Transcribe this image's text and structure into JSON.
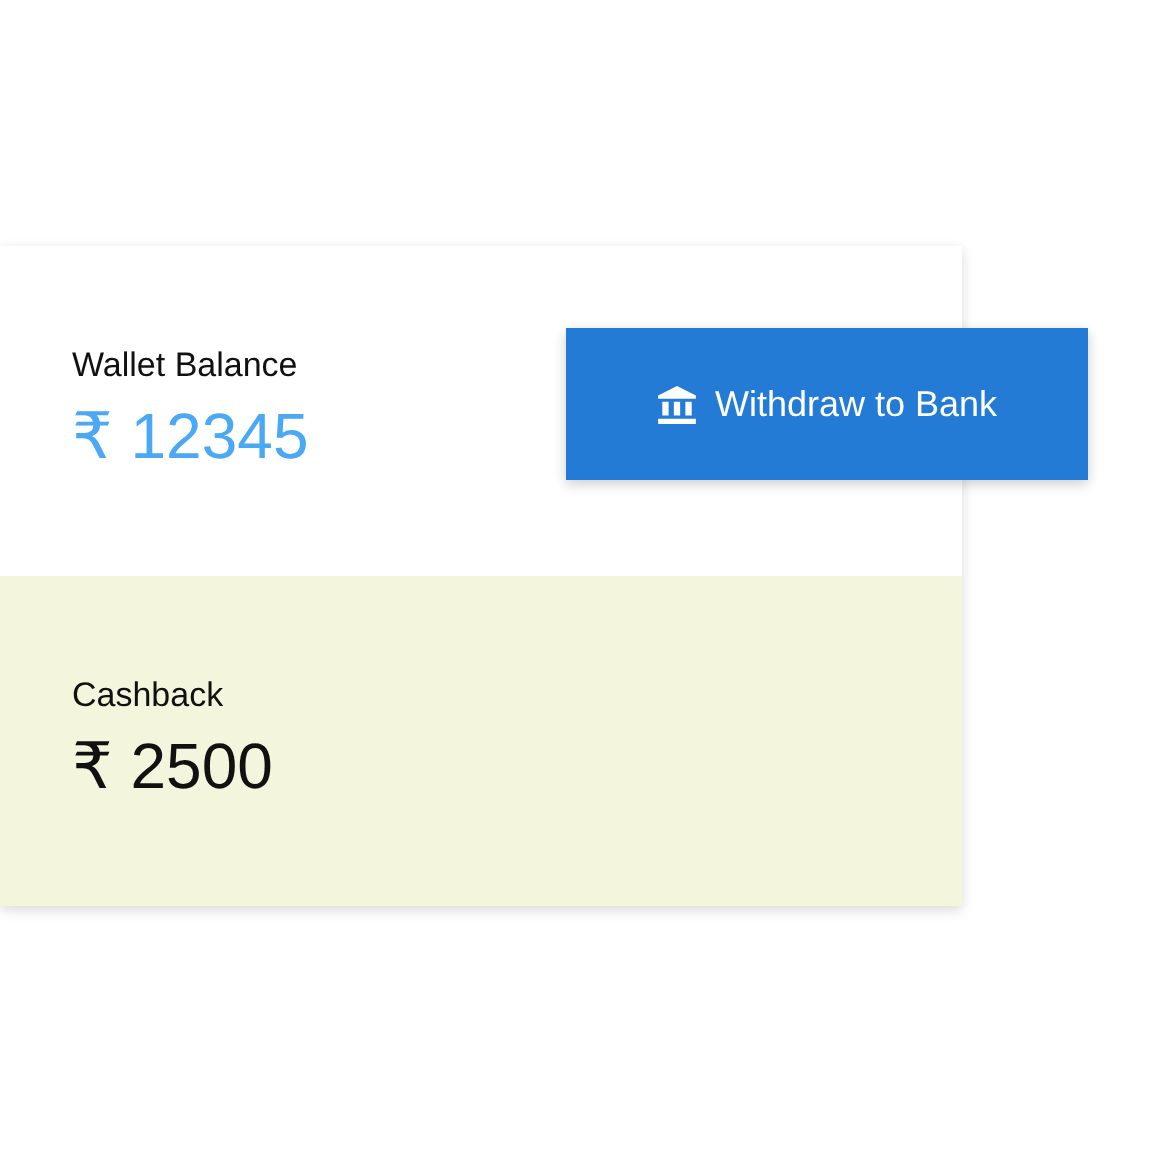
{
  "wallet": {
    "label": "Wallet Balance",
    "amount": "₹ 12345"
  },
  "withdraw_button": {
    "label": "Withdraw to Bank"
  },
  "cashback": {
    "label": "Cashback",
    "amount": "₹ 2500"
  }
}
